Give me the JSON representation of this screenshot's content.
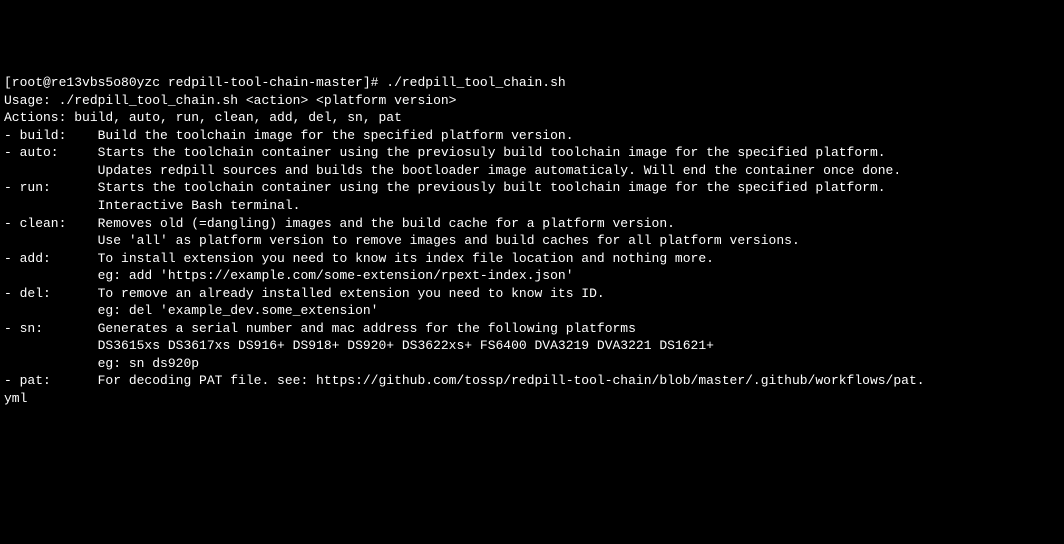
{
  "terminal": {
    "prompt": "[root@re13vbs5o80yzc redpill-tool-chain-master]# ./redpill_tool_chain.sh",
    "usage": "Usage: ./redpill_tool_chain.sh <action> <platform version>",
    "blank": "",
    "actionsList": "Actions: build, auto, run, clean, add, del, sn, pat",
    "build": {
      "name": "- build:    ",
      "line1": "Build the toolchain image for the specified platform version."
    },
    "auto": {
      "name": "- auto:     ",
      "line1": "Starts the toolchain container using the previosuly build toolchain image for the specified platform.",
      "indent": "            ",
      "line2": "Updates redpill sources and builds the bootloader image automaticaly. Will end the container once done."
    },
    "run": {
      "name": "- run:      ",
      "line1": "Starts the toolchain container using the previously built toolchain image for the specified platform.",
      "indent": "            ",
      "line2": "Interactive Bash terminal."
    },
    "clean": {
      "name": "- clean:    ",
      "line1": "Removes old (=dangling) images and the build cache for a platform version.",
      "indent": "            ",
      "line2": "Use 'all' as platform version to remove images and build caches for all platform versions."
    },
    "add": {
      "name": "- add:      ",
      "line1": "To install extension you need to know its index file location and nothing more.",
      "indent": "            ",
      "line2": "eg: add 'https://example.com/some-extension/rpext-index.json'"
    },
    "del": {
      "name": "- del:      ",
      "line1": "To remove an already installed extension you need to know its ID.",
      "indent": "            ",
      "line2": "eg: del 'example_dev.some_extension'"
    },
    "sn": {
      "name": "- sn:       ",
      "line1": "Generates a serial number and mac address for the following platforms",
      "indent": "            ",
      "line2": "DS3615xs DS3617xs DS916+ DS918+ DS920+ DS3622xs+ FS6400 DVA3219 DVA3221 DS1621+",
      "line3": "eg: sn ds920p"
    },
    "pat": {
      "name": "- pat:      ",
      "line1": "For decoding PAT file. see: https://github.com/tossp/redpill-tool-chain/blob/master/.github/workflows/pat.",
      "line2": "yml"
    }
  }
}
